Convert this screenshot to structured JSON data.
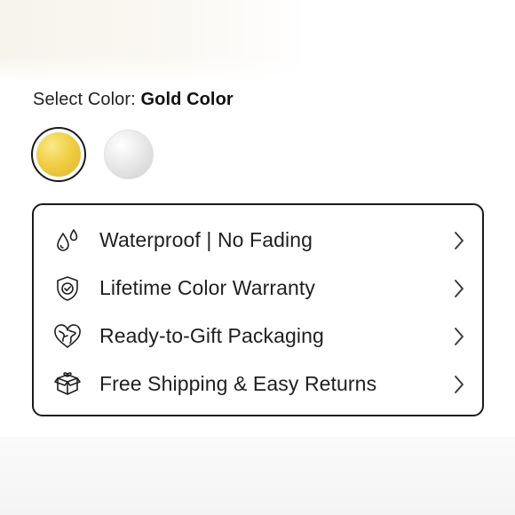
{
  "color_selector": {
    "label": "Select Color:",
    "selected": "Gold Color",
    "swatches": [
      {
        "name": "gold",
        "color": "#efcc44",
        "selected": true
      },
      {
        "name": "silver",
        "color": "#dcdcdc",
        "selected": false
      }
    ]
  },
  "features": [
    {
      "label": "Waterproof | No Fading",
      "icon": "water-drops-icon"
    },
    {
      "label": "Lifetime Color Warranty",
      "icon": "shield-check-icon"
    },
    {
      "label": "Ready-to-Gift Packaging",
      "icon": "heart-globe-icon"
    },
    {
      "label": "Free Shipping & Easy Returns",
      "icon": "gift-box-icon"
    }
  ]
}
